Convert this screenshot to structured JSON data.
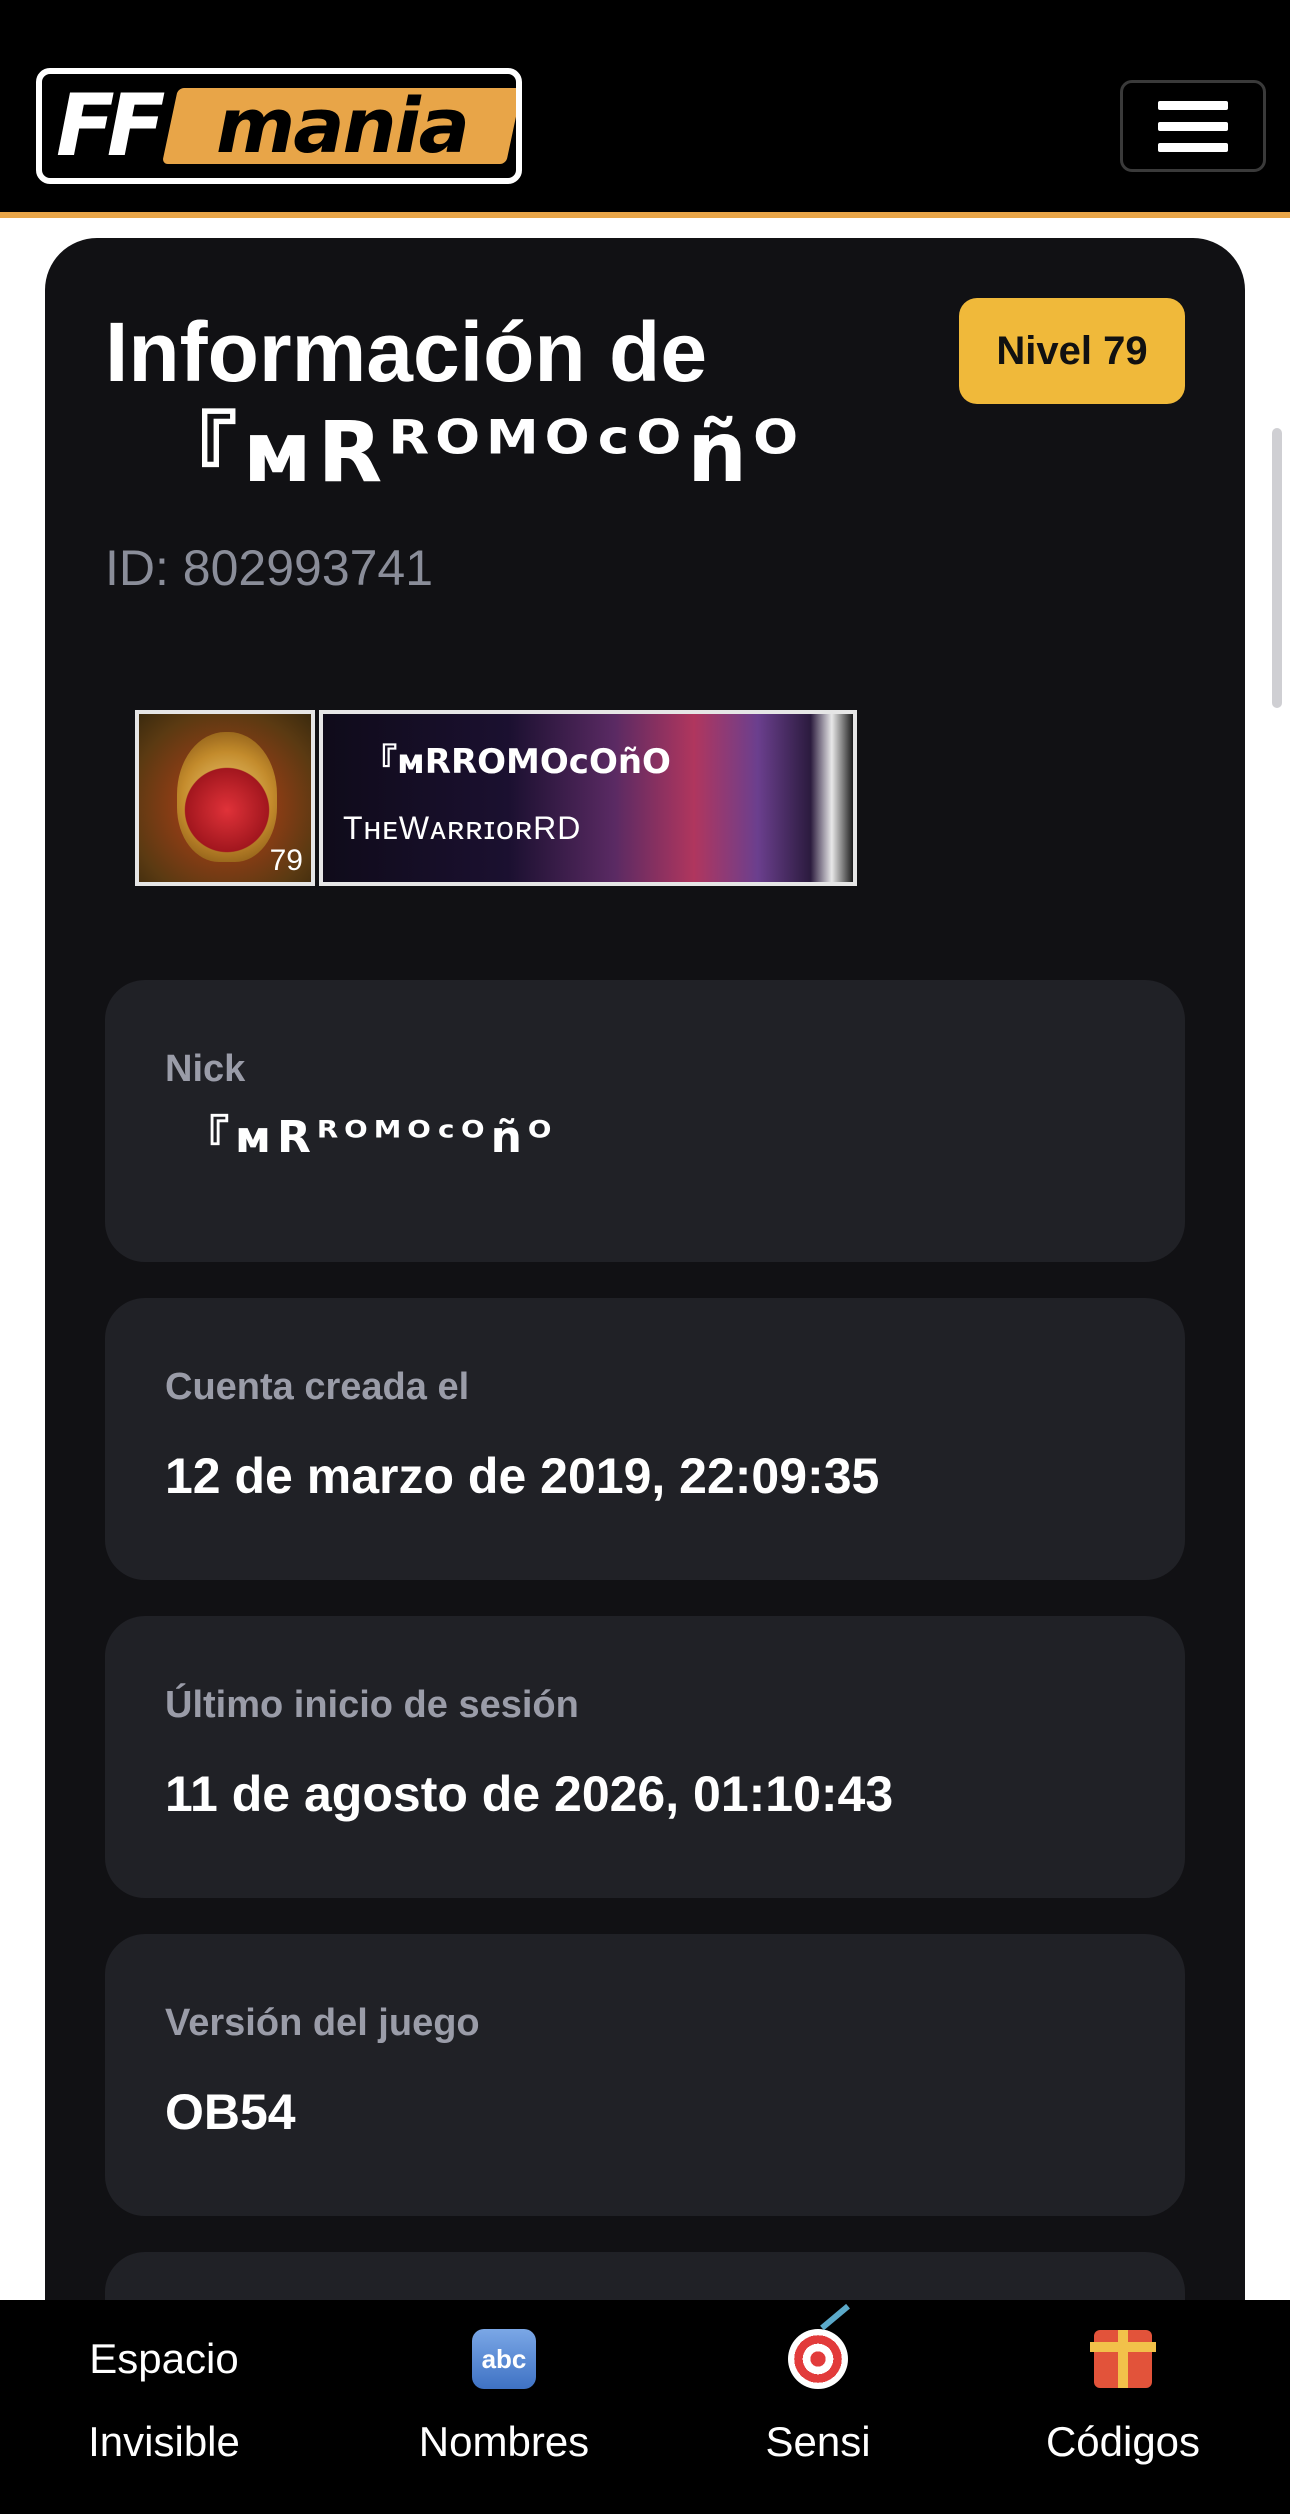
{
  "header": {
    "logo": {
      "ff": "FF",
      "mania": "mania"
    },
    "menu_icon": "hamburger-menu-icon"
  },
  "profile": {
    "title_prefix": "Información de",
    "nick_display": "『ᴍRᴿᴼᴹᴼᶜᴼñᴼ",
    "level_badge": "Nivel 79",
    "id_text": "ID: 802993741",
    "avatar_level": "79",
    "banner_nick": "『ᴍRROMOcOñO",
    "banner_guild": "TʜᴇWᴀʀʀɪᴏʀRD"
  },
  "info_cards": [
    {
      "label": "Nick",
      "value": "『ᴍRᴿᴼᴹᴼᶜᴼñᴼ"
    },
    {
      "label": "Cuenta creada el",
      "value": "12 de marzo de 2019, 22:09:35"
    },
    {
      "label": "Último inicio de sesión",
      "value": "11 de agosto de 2026, 01:10:43"
    },
    {
      "label": "Versión del juego",
      "value": "OB54"
    }
  ],
  "bottom_nav": [
    {
      "top": "Espacio",
      "bottom": "Invisible"
    },
    {
      "icon": "abc-icon",
      "icon_text": "abc",
      "bottom": "Nombres"
    },
    {
      "icon": "target-icon",
      "bottom": "Sensi"
    },
    {
      "icon": "gift-icon",
      "bottom": "Códigos"
    }
  ],
  "colors": {
    "accent": "#f0b93a",
    "header_border": "#e8a548",
    "card_bg": "#111114",
    "box_bg": "#202126",
    "muted_text": "#9a9ca8"
  }
}
